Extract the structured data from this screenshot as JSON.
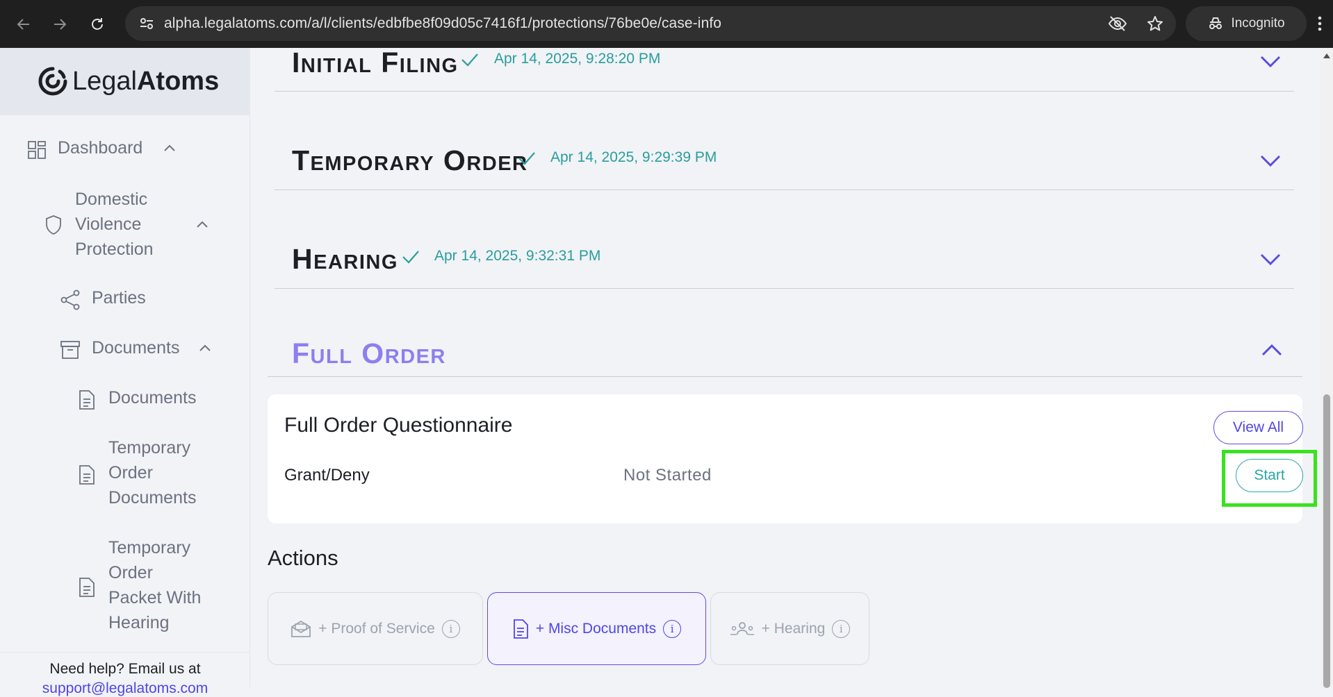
{
  "browser": {
    "url": "alpha.legalatoms.com/a/l/clients/edbfbe8f09d05c7416f1/protections/76be0e/case-info",
    "incognito_label": "Incognito"
  },
  "sidebar": {
    "logo_light": "Legal",
    "logo_bold": "Atoms",
    "dashboard": "Dashboard",
    "protection": [
      "Domestic",
      "Violence",
      "Protection"
    ],
    "parties": "Parties",
    "documents_group": "Documents",
    "documents_item": "Documents",
    "temp_order_docs": [
      "Temporary",
      "Order",
      "Documents"
    ],
    "temp_order_packet": [
      "Temporary",
      "Order",
      "Packet With",
      "Hearing"
    ],
    "help_text": "Need help? Email us at",
    "help_email": "support@legalatoms.com"
  },
  "stages": [
    {
      "title": "Initial Filing",
      "date": "Apr 14, 2025, 9:28:20 PM"
    },
    {
      "title": "Temporary Order",
      "date": "Apr 14, 2025, 9:29:39 PM"
    },
    {
      "title": "Hearing",
      "date": "Apr 14, 2025, 9:32:31 PM"
    },
    {
      "title": "Full Order",
      "date": ""
    }
  ],
  "questionnaire": {
    "title": "Full Order Questionnaire",
    "view_all": "View All",
    "row_name": "Grant/Deny",
    "row_status": "Not Started",
    "start": "Start"
  },
  "actions": {
    "title": "Actions",
    "proof_of_service": "+ Proof of Service",
    "misc_documents": "+ Misc Documents",
    "hearing": "+ Hearing"
  },
  "colors": {
    "accent": "#4f46e5",
    "teal": "#2a9d9d",
    "full_order_title": "#8b7ff0",
    "highlight": "#39e21f"
  }
}
